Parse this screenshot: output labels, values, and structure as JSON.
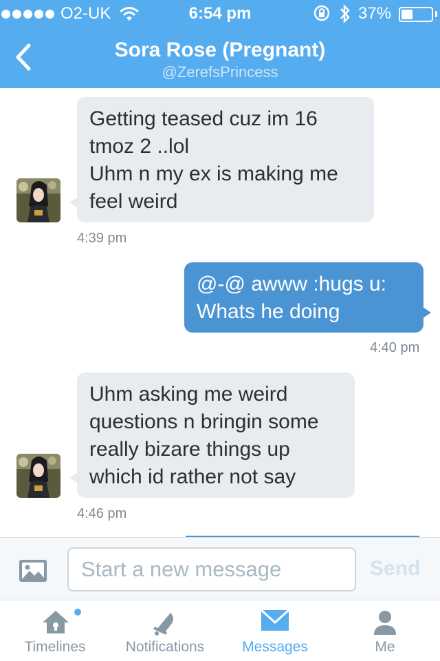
{
  "status_bar": {
    "carrier": "O2-UK",
    "time": "6:54 pm",
    "battery": "37%",
    "battery_level": 0.37
  },
  "nav": {
    "title": "Sora Rose (Pregnant)",
    "handle": "@ZerefsPrincess"
  },
  "messages": [
    {
      "direction": "in",
      "lines": [
        "Getting teased cuz im 16",
        "tmoz 2 ..lol",
        "Uhm n my ex is making me",
        "feel weird"
      ],
      "time": "4:39 pm"
    },
    {
      "direction": "out",
      "lines": [
        "@-@ awww :hugs u:",
        "Whats he doing"
      ],
      "time": "4:40 pm"
    },
    {
      "direction": "in",
      "lines": [
        "Uhm asking me weird",
        "questions n bringin some",
        "really bizare things up",
        "which id rather not say"
      ],
      "time": "4:46 pm"
    }
  ],
  "composer": {
    "placeholder": "Start a new message",
    "send_label": "Send"
  },
  "tabs": [
    {
      "label": "Timelines",
      "icon": "home-icon",
      "active": false
    },
    {
      "label": "Notifications",
      "icon": "bell-icon",
      "active": false
    },
    {
      "label": "Messages",
      "icon": "envelope-icon",
      "active": true
    },
    {
      "label": "Me",
      "icon": "person-icon",
      "active": false
    }
  ],
  "colors": {
    "accent": "#55acee",
    "outgoing_bubble": "#4a94d4",
    "incoming_bubble": "#e8ebef"
  }
}
